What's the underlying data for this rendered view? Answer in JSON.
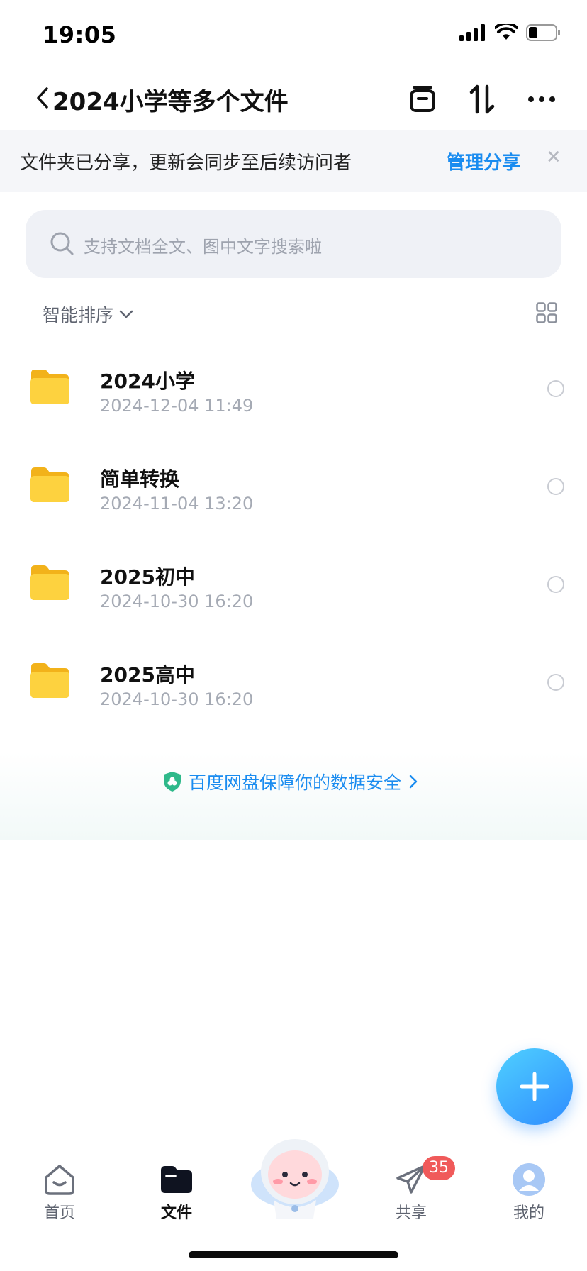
{
  "status_bar": {
    "time": "19:05"
  },
  "header": {
    "title": "2024小学等多个文件"
  },
  "banner": {
    "text": "文件夹已分享，更新会同步至后续访问者",
    "action": "管理分享"
  },
  "search": {
    "placeholder": "支持文档全文、图中文字搜索啦"
  },
  "sort": {
    "label": "智能排序"
  },
  "files": [
    {
      "name": "2024小学",
      "date": "2024-12-04 11:49"
    },
    {
      "name": "简单转换",
      "date": "2024-11-04 13:20"
    },
    {
      "name": "2025初中",
      "date": "2024-10-30 16:20"
    },
    {
      "name": "2025高中",
      "date": "2024-10-30 16:20"
    }
  ],
  "security": {
    "text": "百度网盘保障你的数据安全"
  },
  "tabs": [
    {
      "label": "首页"
    },
    {
      "label": "文件"
    },
    {
      "label": "共享",
      "badge": "35"
    },
    {
      "label": "我的"
    }
  ],
  "colors": {
    "accent": "#1a8cf0",
    "folder": "#fcc63a",
    "badge": "#f05a5a"
  }
}
